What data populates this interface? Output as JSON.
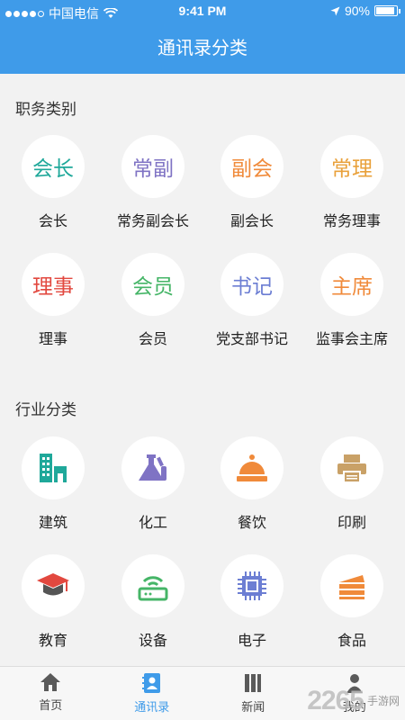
{
  "status_bar": {
    "carrier": "中国电信",
    "time": "9:41 PM",
    "battery": "90%",
    "battery_level": 0.9
  },
  "nav": {
    "title": "通讯录分类"
  },
  "sections": {
    "positions_title": "职务类别",
    "industry_title": "行业分类"
  },
  "positions": [
    {
      "badge": "会长",
      "label": "会长",
      "color": "#1fa89a"
    },
    {
      "badge": "常副",
      "label": "常务副会长",
      "color": "#7f73c4"
    },
    {
      "badge": "副会",
      "label": "副会长",
      "color": "#f08a3a"
    },
    {
      "badge": "常理",
      "label": "常务理事",
      "color": "#e9a13b"
    },
    {
      "badge": "理事",
      "label": "理事",
      "color": "#e2483f"
    },
    {
      "badge": "会员",
      "label": "会员",
      "color": "#45b567"
    },
    {
      "badge": "书记",
      "label": "党支部书记",
      "color": "#6c7ed3"
    },
    {
      "badge": "主席",
      "label": "监事会主席",
      "color": "#f08a3a"
    }
  ],
  "industries": [
    {
      "icon": "building-icon",
      "label": "建筑",
      "color": "#1fa89a"
    },
    {
      "icon": "flask-icon",
      "label": "化工",
      "color": "#7f73c4"
    },
    {
      "icon": "food-dome-icon",
      "label": "餐饮",
      "color": "#f08a3a"
    },
    {
      "icon": "printer-icon",
      "label": "印刷",
      "color": "#c9a167"
    },
    {
      "icon": "graduation-cap-icon",
      "label": "教育",
      "color": "#e2483f"
    },
    {
      "icon": "router-icon",
      "label": "设备",
      "color": "#45b567"
    },
    {
      "icon": "chip-icon",
      "label": "电子",
      "color": "#6c7ed3"
    },
    {
      "icon": "cake-icon",
      "label": "食品",
      "color": "#f08a3a"
    }
  ],
  "tabs": [
    {
      "icon": "home-icon",
      "label": "首页",
      "active": false
    },
    {
      "icon": "contacts-icon",
      "label": "通讯录",
      "active": true
    },
    {
      "icon": "news-icon",
      "label": "新闻",
      "active": false
    },
    {
      "icon": "user-icon",
      "label": "我的",
      "active": false
    }
  ],
  "watermark": {
    "number": "2265",
    "text": "手游网"
  }
}
